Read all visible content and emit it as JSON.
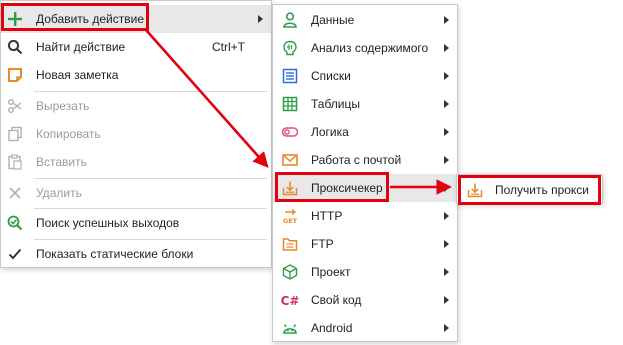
{
  "main_menu": {
    "items": [
      {
        "label": "Добавить действие",
        "icon": "plus-icon",
        "submenu": true
      },
      {
        "label": "Найти действие",
        "icon": "search-icon",
        "shortcut": "Ctrl+T"
      },
      {
        "label": "Новая заметка",
        "icon": "note-icon"
      },
      {
        "label": "Вырезать",
        "icon": "scissors-icon"
      },
      {
        "label": "Копировать",
        "icon": "copy-icon"
      },
      {
        "label": "Вставить",
        "icon": "paste-icon"
      },
      {
        "label": "Удалить",
        "icon": "delete-icon"
      },
      {
        "label": "Поиск успешных выходов",
        "icon": "search-success-icon"
      },
      {
        "label": "Показать статические блоки",
        "icon": "checkmark-icon"
      }
    ]
  },
  "submenu": {
    "items": [
      {
        "label": "Данные",
        "icon": "user-data-icon"
      },
      {
        "label": "Анализ содержимого",
        "icon": "brain-analysis-icon"
      },
      {
        "label": "Списки",
        "icon": "list-icon"
      },
      {
        "label": "Таблицы",
        "icon": "table-icon"
      },
      {
        "label": "Логика",
        "icon": "logic-toggle-icon"
      },
      {
        "label": "Работа с почтой",
        "icon": "mail-icon"
      },
      {
        "label": "Проксичекер",
        "icon": "proxy-download-icon"
      },
      {
        "label": "HTTP",
        "icon": "http-get-icon",
        "icon_text": "GET"
      },
      {
        "label": "FTP",
        "icon": "ftp-icon"
      },
      {
        "label": "Проект",
        "icon": "project-cube-icon"
      },
      {
        "label": "Свой код",
        "icon": "csharp-icon",
        "icon_text": "C#"
      },
      {
        "label": "Android",
        "icon": "android-icon"
      }
    ]
  },
  "submenu2": {
    "items": [
      {
        "label": "Получить прокси",
        "icon": "proxy-download-icon"
      }
    ]
  },
  "colors": {
    "highlight_box": "#e3000f",
    "green": "#2e9d4a",
    "orange": "#e8892b",
    "blue": "#2b6fd6",
    "pink": "#e0527a",
    "purple": "#d0306a"
  }
}
